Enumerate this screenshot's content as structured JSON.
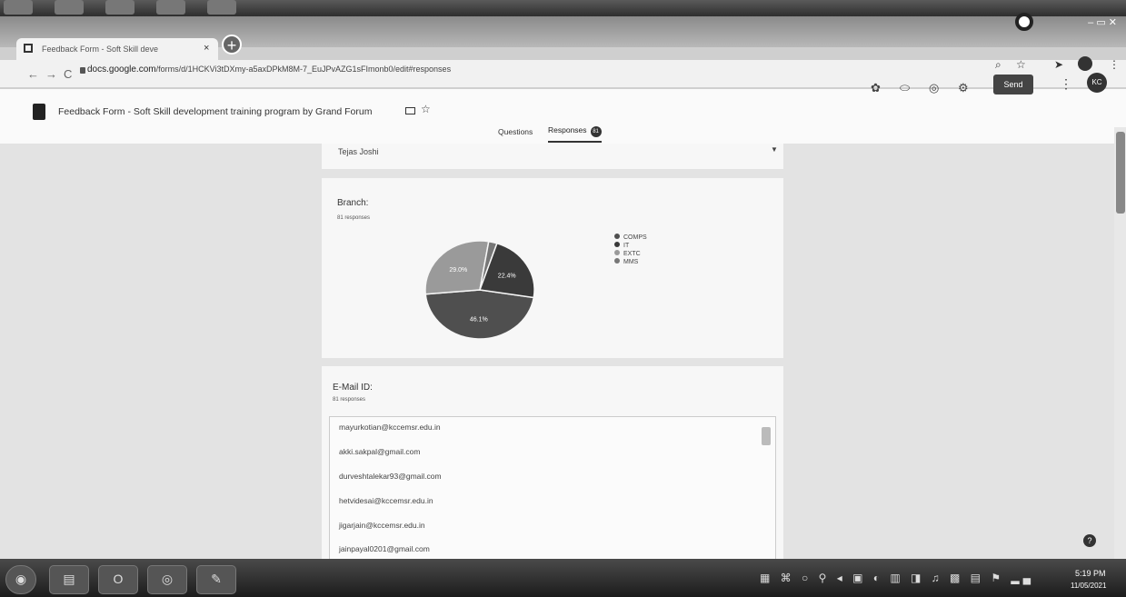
{
  "browser": {
    "tab_title": "Feedback Form - Soft Skill deve",
    "tab_close": "×",
    "new_tab": "+",
    "url_domain": "docs.google.com",
    "url_path": "/forms/d/1HCKVi3tDXmy-a5axDPkM8M-7_EuJPvAZG1sFImonb0/edit#responses",
    "nav_back": "←",
    "nav_forward": "→",
    "nav_reload": "C",
    "win_controls": "– ▭ ✕"
  },
  "form": {
    "title": "Feedback Form - Soft Skill development training program by Grand Forum",
    "send_label": "Send",
    "avatar_initials": "KC",
    "tab_questions": "Questions",
    "tab_responses": "Responses",
    "responses_badge": "81"
  },
  "name_summary": {
    "value": "Tejas Joshi"
  },
  "branch": {
    "title": "Branch:",
    "count": "81 responses"
  },
  "chart_data": {
    "type": "pie",
    "labels": [
      "COMPS",
      "IT",
      "EXTC",
      "MMS"
    ],
    "values": [
      46.1,
      22.4,
      29.0,
      2.5
    ],
    "printed_labels": [
      "46.1%",
      "22.4%",
      "29.0%"
    ],
    "colors": [
      "#4f4f4f",
      "#3a3a3a",
      "#9a9a9a",
      "#777777"
    ],
    "legend": "right"
  },
  "email": {
    "title": "E-Mail ID:",
    "count": "81 responses",
    "rows": [
      "mayurkotian@kccemsr.edu.in",
      "akki.sakpal@gmail.com",
      "durveshtalekar93@gmail.com",
      "hetvidesai@kccemsr.edu.in",
      "jigarjain@kccemsr.edu.in",
      "jainpayal0201@gmail.com"
    ]
  },
  "taskbar": {
    "time": "5:19 PM",
    "date": "11/05/2021"
  }
}
